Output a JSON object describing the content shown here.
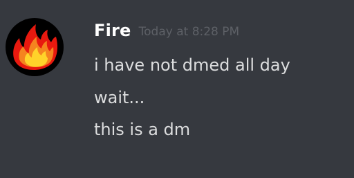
{
  "message": {
    "author": "Fire",
    "timestamp": "Today at 8:28 PM",
    "avatar_icon": "fire-icon",
    "lines": [
      "i have not dmed all day",
      "wait...",
      "this is a dm"
    ]
  },
  "colors": {
    "background": "#36393f",
    "author": "#ffffff",
    "timestamp": "#5d6066",
    "text": "#dcddde",
    "flame_outer": "#e8190f",
    "flame_middle": "#f5841f",
    "flame_inner": "#ffd32a"
  }
}
